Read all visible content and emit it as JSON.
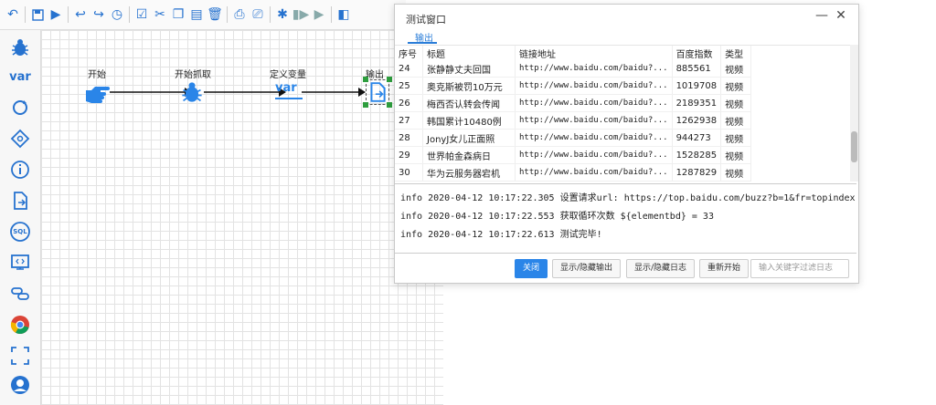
{
  "toolbar": {
    "icons": [
      "undo-icon",
      "save-icon",
      "run-icon",
      "back-icon",
      "forward-icon",
      "history-icon",
      "check-icon",
      "cut-icon",
      "copy-icon",
      "paste-icon",
      "delete-icon",
      "export-icon",
      "print-icon",
      "debug-icon",
      "step-icon",
      "play-icon",
      "window-icon"
    ]
  },
  "sidebar": {
    "var_label": "var",
    "sql_label": "SQL"
  },
  "flow": {
    "nodes": [
      {
        "label": "开始"
      },
      {
        "label": "开始抓取"
      },
      {
        "label": "定义变量",
        "icon_text": "var"
      },
      {
        "label": "输出"
      }
    ]
  },
  "dialog": {
    "title": "测试窗口",
    "minimize": "—",
    "close": "✕",
    "tab": "输出",
    "columns": [
      "序号",
      "标题",
      "链接地址",
      "百度指数",
      "类型"
    ],
    "rows": [
      [
        "24",
        "张静静丈夫回国",
        "http://www.baidu.com/baidu?...",
        "885561",
        "视频"
      ],
      [
        "25",
        "奥克斯被罚10万元",
        "http://www.baidu.com/baidu?...",
        "1019708",
        "视频"
      ],
      [
        "26",
        "梅西否认转会传闻",
        "http://www.baidu.com/baidu?...",
        "2189351",
        "视频"
      ],
      [
        "27",
        "韩国累计10480例",
        "http://www.baidu.com/baidu?...",
        "1262938",
        "视频"
      ],
      [
        "28",
        "JonyJ女儿正面照",
        "http://www.baidu.com/baidu?...",
        "944273",
        "视频"
      ],
      [
        "29",
        "世界帕金森病日",
        "http://www.baidu.com/baidu?...",
        "1528285",
        "视频"
      ],
      [
        "30",
        "华为云服务器宕机",
        "http://www.baidu.com/baidu?...",
        "1287829",
        "视频"
      ]
    ],
    "logs": [
      "info  2020-04-12 10:17:22.305  设置请求url: https://top.baidu.com/buzz?b=1&fr=topindex",
      "info  2020-04-12 10:17:22.553  获取循环次数  ${elementbd} = 33",
      "info  2020-04-12 10:17:22.613  测试完毕!"
    ],
    "buttons": {
      "close": "关闭",
      "toggle_output": "显示/隐藏输出",
      "toggle_log": "显示/隐藏日志",
      "restart": "重新开始",
      "filter_placeholder": "输入关键字过滤日志"
    }
  },
  "colors": {
    "accent": "#2a85e8",
    "icon_blue": "#2672cf"
  }
}
